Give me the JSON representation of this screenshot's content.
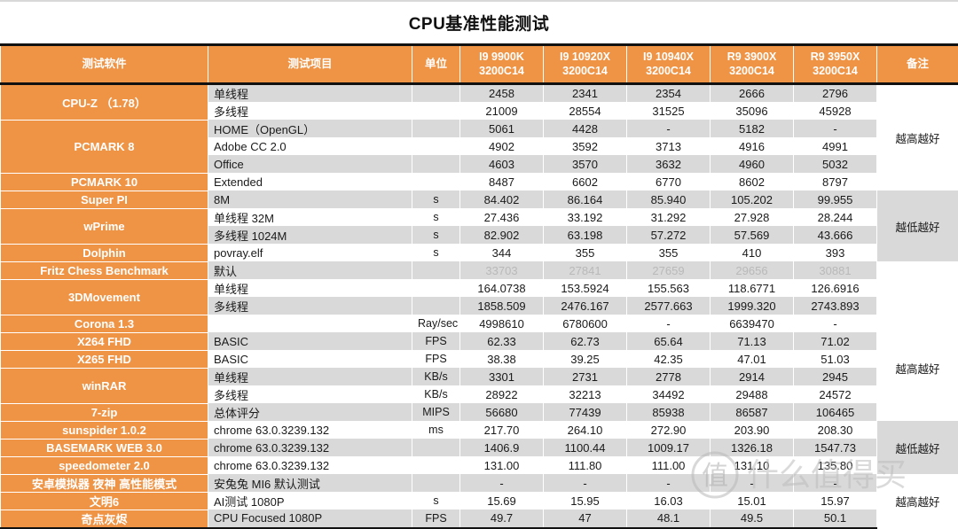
{
  "title": "CPU基准性能测试",
  "colors": {
    "header_orange": "#ef9345",
    "row_grey": "#d9d9d9",
    "row_white": "#ffffff",
    "dim_text": "#b9b9b9"
  },
  "columns": [
    {
      "key": "software",
      "label": "测试软件"
    },
    {
      "key": "item",
      "label": "测试项目"
    },
    {
      "key": "unit",
      "label": "单位"
    },
    {
      "key": "c1",
      "label_line1": "I9 9900K",
      "label_line2": "3200C14"
    },
    {
      "key": "c2",
      "label_line1": "I9 10920X",
      "label_line2": "3200C14"
    },
    {
      "key": "c3",
      "label_line1": "I9 10940X",
      "label_line2": "3200C14"
    },
    {
      "key": "c4",
      "label_line1": "R9 3900X",
      "label_line2": "3200C14"
    },
    {
      "key": "c5",
      "label_line1": "R9 3950X",
      "label_line2": "3200C14"
    },
    {
      "key": "note",
      "label": "备注"
    }
  ],
  "software_groups": [
    {
      "label": "CPU-Z",
      "version": "（1.78）",
      "rows": 2
    },
    {
      "label": "PCMARK 8",
      "version": "",
      "rows": 3
    },
    {
      "label": "PCMARK 10",
      "version": "",
      "rows": 1
    },
    {
      "label": "Super PI",
      "version": "",
      "rows": 1
    },
    {
      "label": "wPrime",
      "version": "",
      "rows": 2
    },
    {
      "label": "Dolphin",
      "version": "",
      "rows": 1
    },
    {
      "label": "Fritz Chess Benchmark",
      "version": "",
      "rows": 1
    },
    {
      "label": "3DMovement",
      "version": "",
      "rows": 2
    },
    {
      "label": "Corona 1.3",
      "version": "",
      "rows": 1
    },
    {
      "label": "X264 FHD",
      "version": "",
      "rows": 1
    },
    {
      "label": "X265 FHD",
      "version": "",
      "rows": 1
    },
    {
      "label": "winRAR",
      "version": "",
      "rows": 2
    },
    {
      "label": "7-zip",
      "version": "",
      "rows": 1
    },
    {
      "label": "sunspider 1.0.2",
      "version": "",
      "rows": 1
    },
    {
      "label": "BASEMARK WEB 3.0",
      "version": "",
      "rows": 1
    },
    {
      "label": "speedometer 2.0",
      "version": "",
      "rows": 1
    },
    {
      "label": "安卓模拟器 夜神 高性能模式",
      "version": "",
      "rows": 1
    },
    {
      "label": "文明6",
      "version": "",
      "rows": 1
    },
    {
      "label": "奇点灰烬",
      "version": "",
      "rows": 1
    }
  ],
  "note_groups": [
    {
      "label": "越高越好",
      "rows": 6,
      "shade": "white"
    },
    {
      "label": "越低越好",
      "rows": 4,
      "shade": "grey"
    },
    {
      "label": "",
      "rows": 3,
      "shade": "white"
    },
    {
      "label": "越高越好",
      "rows": 6,
      "shade": "white"
    },
    {
      "label": "越低越好",
      "rows": 3,
      "shade": "grey"
    },
    {
      "label": "越高越好",
      "rows": 3,
      "shade": "white"
    }
  ],
  "rows": [
    {
      "item": "单线程",
      "unit": "",
      "values": [
        "2458",
        "2341",
        "2354",
        "2666",
        "2796"
      ],
      "shade": "grey",
      "dim": false
    },
    {
      "item": "多线程",
      "unit": "",
      "values": [
        "21009",
        "28554",
        "31525",
        "35096",
        "45928"
      ],
      "shade": "white",
      "dim": false
    },
    {
      "item": "HOME（OpenGL）",
      "unit": "",
      "values": [
        "5061",
        "4428",
        "-",
        "5182",
        "-"
      ],
      "shade": "grey",
      "dim": false
    },
    {
      "item": "Adobe CC 2.0",
      "unit": "",
      "values": [
        "4902",
        "3592",
        "3713",
        "4916",
        "4991"
      ],
      "shade": "white",
      "dim": false
    },
    {
      "item": "Office",
      "unit": "",
      "values": [
        "4603",
        "3570",
        "3632",
        "4960",
        "5032"
      ],
      "shade": "grey",
      "dim": false
    },
    {
      "item": "Extended",
      "unit": "",
      "values": [
        "8487",
        "6602",
        "6770",
        "8602",
        "8797"
      ],
      "shade": "white",
      "dim": false
    },
    {
      "item": "8M",
      "unit": "s",
      "values": [
        "84.402",
        "86.164",
        "85.940",
        "105.202",
        "99.955"
      ],
      "shade": "grey",
      "dim": false
    },
    {
      "item": "单线程 32M",
      "unit": "s",
      "values": [
        "27.436",
        "33.192",
        "31.292",
        "27.928",
        "28.244"
      ],
      "shade": "white",
      "dim": false
    },
    {
      "item": "多线程 1024M",
      "unit": "s",
      "values": [
        "82.902",
        "63.198",
        "57.272",
        "57.569",
        "43.666"
      ],
      "shade": "grey",
      "dim": false
    },
    {
      "item": "povray.elf",
      "unit": "s",
      "values": [
        "344",
        "355",
        "355",
        "410",
        "393"
      ],
      "shade": "white",
      "dim": false
    },
    {
      "item": "默认",
      "unit": "",
      "values": [
        "33703",
        "27841",
        "27659",
        "29656",
        "30881"
      ],
      "shade": "grey",
      "dim": true
    },
    {
      "item": "单线程",
      "unit": "",
      "values": [
        "164.0738",
        "153.5924",
        "155.563",
        "118.6771",
        "126.6916"
      ],
      "shade": "white",
      "dim": false
    },
    {
      "item": "多线程",
      "unit": "",
      "values": [
        "1858.509",
        "2476.167",
        "2577.663",
        "1999.320",
        "2743.893"
      ],
      "shade": "grey",
      "dim": false
    },
    {
      "item": "",
      "unit": "Ray/sec",
      "values": [
        "4998610",
        "6780600",
        "-",
        "6639470",
        "-"
      ],
      "shade": "white",
      "dim": false
    },
    {
      "item": "BASIC",
      "unit": "FPS",
      "values": [
        "62.33",
        "62.73",
        "65.64",
        "71.13",
        "71.02"
      ],
      "shade": "grey",
      "dim": false
    },
    {
      "item": "BASIC",
      "unit": "FPS",
      "values": [
        "38.38",
        "39.25",
        "42.35",
        "47.01",
        "51.03"
      ],
      "shade": "white",
      "dim": false
    },
    {
      "item": "单线程",
      "unit": "KB/s",
      "values": [
        "3301",
        "2731",
        "2778",
        "2914",
        "2945"
      ],
      "shade": "grey",
      "dim": false
    },
    {
      "item": "多线程",
      "unit": "KB/s",
      "values": [
        "28922",
        "32213",
        "34492",
        "29488",
        "24572"
      ],
      "shade": "white",
      "dim": false
    },
    {
      "item": "总体评分",
      "unit": "MIPS",
      "values": [
        "56680",
        "77439",
        "85938",
        "86587",
        "106465"
      ],
      "shade": "grey",
      "dim": false
    },
    {
      "item": "chrome 63.0.3239.132",
      "unit": "ms",
      "values": [
        "217.70",
        "264.10",
        "272.90",
        "203.90",
        "208.30"
      ],
      "shade": "white",
      "dim": false
    },
    {
      "item": "chrome 63.0.3239.132",
      "unit": "",
      "values": [
        "1406.9",
        "1100.44",
        "1009.17",
        "1326.18",
        "1547.73"
      ],
      "shade": "grey",
      "dim": false
    },
    {
      "item": "chrome 63.0.3239.132",
      "unit": "",
      "values": [
        "131.00",
        "111.80",
        "111.00",
        "131.10",
        "135.80"
      ],
      "shade": "white",
      "dim": false
    },
    {
      "item": "安兔兔 MI6 默认测试",
      "unit": "",
      "values": [
        "-",
        "-",
        "-",
        "-",
        "-"
      ],
      "shade": "grey",
      "dim": false
    },
    {
      "item": "AI测试 1080P",
      "unit": "s",
      "values": [
        "15.69",
        "15.95",
        "16.03",
        "15.01",
        "15.97"
      ],
      "shade": "white",
      "dim": false
    },
    {
      "item": "CPU Focused 1080P",
      "unit": "FPS",
      "values": [
        "49.7",
        "47",
        "48.1",
        "49.5",
        "50.1"
      ],
      "shade": "grey",
      "dim": false
    }
  ],
  "watermark": {
    "text": "什么值得买",
    "badge": "值"
  }
}
